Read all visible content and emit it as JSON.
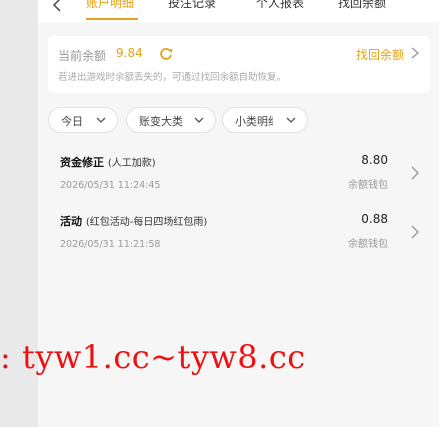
{
  "tabs": [
    {
      "label": "账户明细",
      "active": true
    },
    {
      "label": "投注记录",
      "active": false
    },
    {
      "label": "个人报表",
      "active": false
    },
    {
      "label": "找回余额",
      "active": false
    }
  ],
  "balance": {
    "label": "当前余额",
    "value": "9.84",
    "recover_link": "找回余额",
    "note": "若进出游戏时余额丢失的，可通过找回余额自助恢复。"
  },
  "filters": [
    {
      "label": "今日"
    },
    {
      "label": "账变大类"
    },
    {
      "label": "小类明细"
    }
  ],
  "transactions": [
    {
      "title": "资金修正",
      "subtitle": "(人工加款)",
      "time": "2026/05/31 11:24:45",
      "amount": "8.80",
      "wallet": "余额钱包"
    },
    {
      "title": "活动",
      "subtitle": "(红包活动-每日四场红包雨)",
      "time": "2026/05/31 11:21:58",
      "amount": "0.88",
      "wallet": "余额钱包"
    }
  ],
  "watermark": ": tyw1.cc~tyw8.cc",
  "colors": {
    "accent": "#e3a314",
    "watermark": "#ee1111"
  }
}
